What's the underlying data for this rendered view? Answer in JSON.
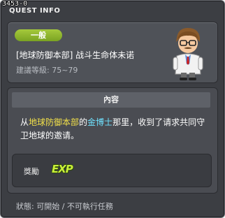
{
  "window": {
    "id_text": "3453-0",
    "title": "QUEST INFO"
  },
  "quest": {
    "category_badge": "一般",
    "name": "[地球防御本部] 战斗生命体未诺",
    "level_text": "建議等級: 75~79",
    "npc_icon": "doctor-npc-portrait"
  },
  "content": {
    "header": "內容",
    "description": {
      "part1": "从",
      "place": "地球防御本部",
      "part2": "的",
      "npc": "金博士",
      "part3": "那里，收到了请求共同守卫地球的邀请。"
    }
  },
  "reward": {
    "label": "獎勵",
    "item": "EXP"
  },
  "status": {
    "text": "狀態: 可開始 / 不可執行任務"
  },
  "colors": {
    "highlight_place": "#f3e14a",
    "highlight_npc": "#6fe2ff",
    "badge": "#8fb82c",
    "exp": "#c9ef3a"
  }
}
